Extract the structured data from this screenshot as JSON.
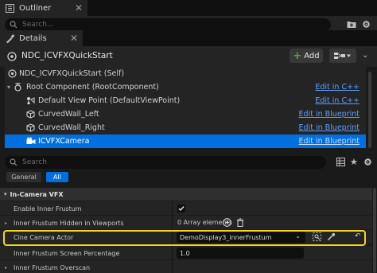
{
  "outliner": {
    "tab_label": "Outliner",
    "search_placeholder": "Search..."
  },
  "details": {
    "tab_label": "Details",
    "actor_name": "NDC_ICVFXQuickStart",
    "add_label": "Add",
    "tree": [
      {
        "label": "NDC_ICVFXQuickStart (Self)",
        "link": ""
      },
      {
        "label": "Root Component (RootComponent)",
        "link": "Edit in C++"
      },
      {
        "label": "Default View Point (DefaultViewPoint)",
        "link": "Edit in C++"
      },
      {
        "label": "CurvedWall_Left",
        "link": "Edit in Blueprint"
      },
      {
        "label": "CurvedWall_Right",
        "link": "Edit in Blueprint"
      },
      {
        "label": "ICVFXCamera",
        "link": "Edit in Blueprint"
      }
    ],
    "search_placeholder": "Search",
    "categories": {
      "general": "General",
      "all": "All"
    },
    "section_title": "In-Camera VFX",
    "properties": [
      {
        "label": "Enable Inner Frustum",
        "value": ""
      },
      {
        "label": "Inner Frustum Hidden in Viewports",
        "value": "0 Array elements"
      },
      {
        "label": "Cine Camera Actor",
        "value": "DemoDisplay3_innerFrustum"
      },
      {
        "label": "Inner Frustum Screen Percentage",
        "value": "1.0"
      },
      {
        "label": "Inner Frustum Overscan",
        "value": ""
      }
    ],
    "enable_inner_frustum": true
  },
  "colors": {
    "selection": "#0070e0",
    "link": "#5c9fff",
    "highlight": "#f5d61b",
    "add_plus": "#43b043"
  }
}
